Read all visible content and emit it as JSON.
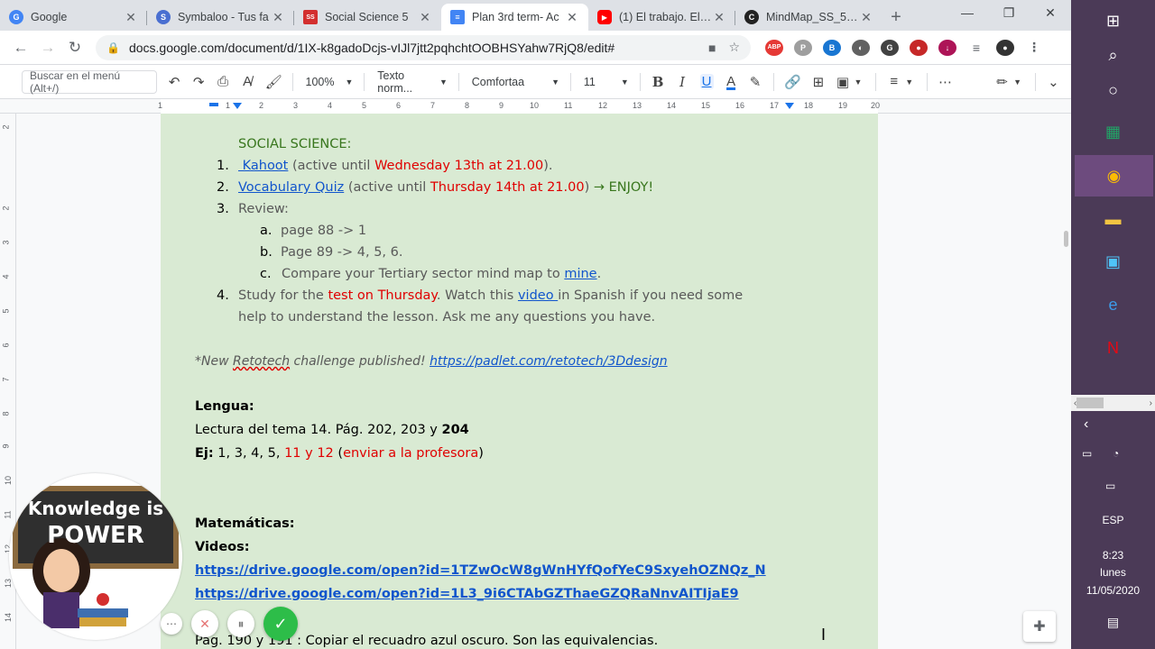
{
  "tabs": [
    {
      "title": "Google",
      "favicon_color": "#4285f4",
      "favicon": "G"
    },
    {
      "title": "Symbaloo - Tus fa",
      "favicon_color": "#4a6fd1",
      "favicon": "S"
    },
    {
      "title": "Social Science 5",
      "favicon_color": "#d32f2f",
      "favicon": "SS"
    },
    {
      "title": "Plan 3rd term- Ac",
      "favicon_color": "#4285f4",
      "favicon": "D"
    },
    {
      "title": "(1) El trabajo. El se",
      "favicon_color": "#ff0000",
      "favicon": "▶"
    },
    {
      "title": "MindMap_SS_5.1_",
      "favicon_color": "#222222",
      "favicon": "C"
    }
  ],
  "address": {
    "url": "docs.google.com/document/d/1IX-k8gadoDcjs-vIJl7jtt2pqhchtOOBHSYahw7RjQ8/edit#"
  },
  "toolbar": {
    "menu_search": "Buscar en el menú (Alt+/)",
    "zoom": "100%",
    "style": "Texto norm...",
    "font": "Comfortaa",
    "size": "11",
    "bold": "B",
    "italic": "I",
    "underline": "U",
    "textcolor": "A"
  },
  "ruler": {
    "ticks": [
      "1",
      "1",
      "2",
      "3",
      "4",
      "5",
      "6",
      "7",
      "8",
      "9",
      "10",
      "11",
      "12",
      "13",
      "14",
      "15",
      "16",
      "17",
      "18",
      "19",
      "20"
    ]
  },
  "vruler": {
    "ticks": [
      "2",
      "1",
      "1",
      "2",
      "3",
      "4",
      "5",
      "6",
      "7",
      "8",
      "9",
      "10",
      "11",
      "12",
      "13",
      "14",
      "15",
      "16",
      "17"
    ]
  },
  "doc": {
    "ss_heading": "SOCIAL SCIENCE:",
    "i1_num": "1.",
    "i1_link": " Kahoot",
    "i1_t1": " (active until ",
    "i1_red": "Wednesday 13th at 21.00",
    "i1_t2": ").",
    "i2_num": "2.",
    "i2_link": "Vocabulary Quiz",
    "i2_t1": " (active until ",
    "i2_red": "Thursday 14th at 21.00",
    "i2_t2": ") ",
    "i2_grn": "→ ENJOY!",
    "i3_num": "3.",
    "i3_text": "Review:",
    "a_num": "a.",
    "a_text": "page 88 -> 1",
    "b_num": "b.",
    "b_text": "Page 89 -> 4, 5, 6.",
    "c_num": "c.",
    "c_text": "Compare your Tertiary sector mind map to ",
    "c_link": "mine",
    "c_end": ".",
    "i4_num": "4.",
    "i4_t1": "Study for the ",
    "i4_red": "test on Thursday",
    "i4_t2": ". Watch this ",
    "i4_link": "video ",
    "i4_t3": "in Spanish if you need some",
    "i4_line2": "help to understand the lesson. Ask me any questions you have.",
    "retotech_t1": "*New ",
    "retotech_word": "Retotech",
    "retotech_t2": " challenge published! ",
    "retotech_link": "https://padlet.com/retotech/3Ddesign",
    "lengua_head": "Lengua:",
    "lectura_t1": "Lectura del tema 14. Pág. 202, 203 y ",
    "lectura_b": "204",
    "ej_b": "Ej:",
    "ej_t1": " 1, 3, 4, 5, ",
    "ej_red": "11 y 12",
    "ej_t2": " (",
    "ej_red2": "enviar a la profesora",
    "ej_t3": ")",
    "mat_head": "Matemáticas:",
    "videos_head": "Videos:",
    "link1": "https://drive.google.com/open?id=1TZwOcW8gWnHYfQofYeC9SxyehOZNQz_N",
    "link2": "https://drive.google.com/open?id=1L3_9i6CTAbGZThaeGZQRaNnvAITIjaE9",
    "pag_line": "Pág. 190 y 191 : Copiar el recuadro azul oscuro. Son las equivalencias."
  },
  "avatar": {
    "line1": "Knowledge is",
    "line2": "POWER"
  },
  "taskbar": {
    "lang": "ESP",
    "time": "8:23",
    "day": "lunes",
    "date": "11/05/2020"
  },
  "colors": {
    "page_bg": "#d9ead3",
    "taskbar_bg": "#4b3a57",
    "link": "#1155cc",
    "red": "#e00000",
    "green": "#38761d"
  }
}
